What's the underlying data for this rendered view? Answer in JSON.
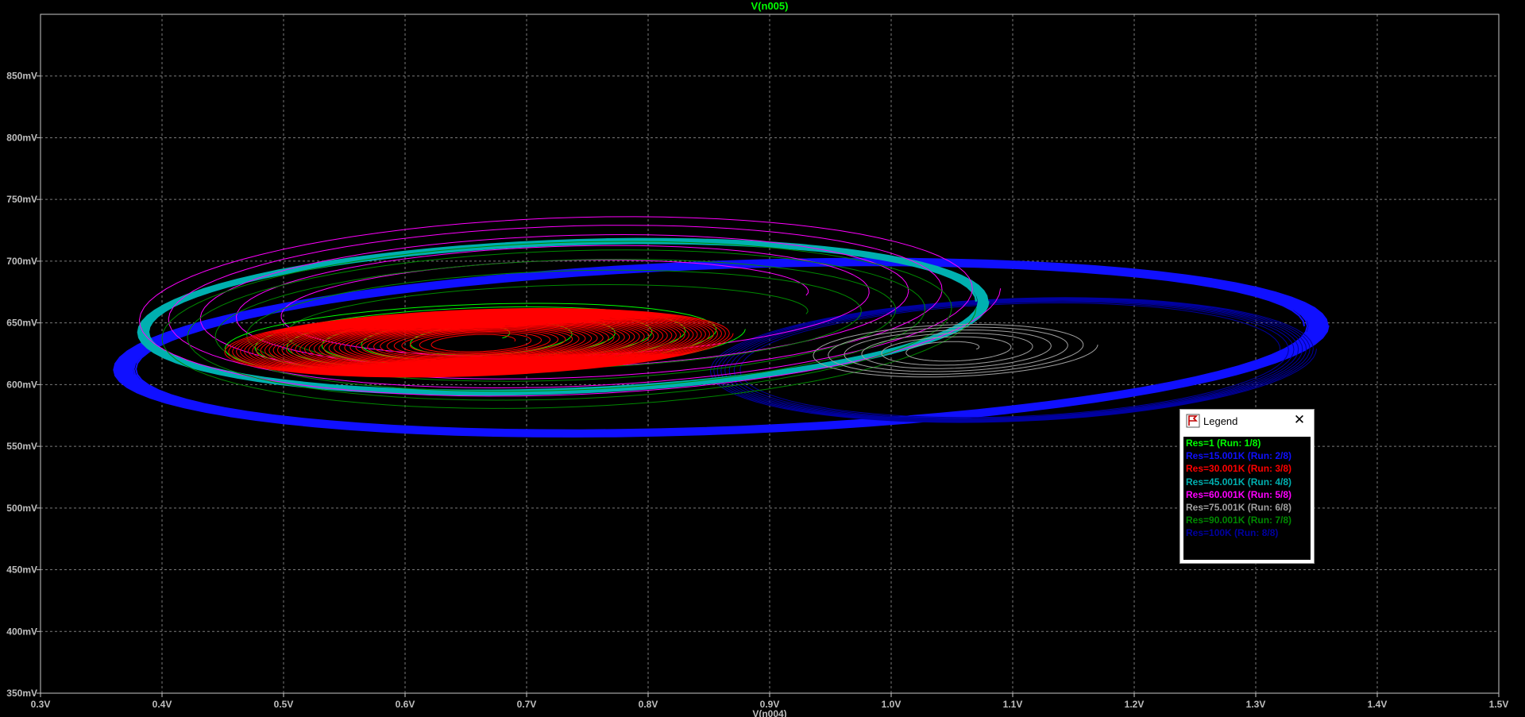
{
  "chart_data": {
    "type": "scatter",
    "title": "V(n005)",
    "xlabel": "V(n004)",
    "xlim": [
      0.3,
      1.5
    ],
    "ylim": [
      350,
      900
    ],
    "xticks": [
      "0.3V",
      "0.4V",
      "0.5V",
      "0.6V",
      "0.7V",
      "0.8V",
      "0.9V",
      "1.0V",
      "1.1V",
      "1.2V",
      "1.3V",
      "1.4V",
      "1.5V"
    ],
    "yticks": [
      "350mV",
      "400mV",
      "450mV",
      "500mV",
      "550mV",
      "600mV",
      "650mV",
      "700mV",
      "750mV",
      "800mV",
      "850mV"
    ],
    "grid": true,
    "legend_position": "bottom-right",
    "series": [
      {
        "name": "Res=1  (Run: 1/8)",
        "color": "#00ff00",
        "center": [
          0.66,
          637
        ],
        "rx": [
          0.02,
          0.22
        ],
        "ry": [
          8,
          30
        ],
        "turns": 6
      },
      {
        "name": "Res=15.001K  (Run: 2/8)",
        "color": "#1010ff",
        "center": [
          0.86,
          630
        ],
        "rx": [
          0.48,
          0.5
        ],
        "ry": [
          64,
          70
        ],
        "turns": 20
      },
      {
        "name": "Res=30.001K  (Run: 3/8)",
        "color": "#ff0000",
        "center": [
          0.66,
          634
        ],
        "rx": [
          0.03,
          0.21
        ],
        "ry": [
          6,
          27
        ],
        "turns": 40
      },
      {
        "name": "Res=45.001K  (Run: 4/8)",
        "color": "#00b0b0",
        "center": [
          0.73,
          655
        ],
        "rx": [
          0.34,
          0.35
        ],
        "ry": [
          58,
          62
        ],
        "turns": 10
      },
      {
        "name": "Res=60.001K  (Run: 5/8)",
        "color": "#ff00ff",
        "center": [
          0.73,
          665
        ],
        "rx": [
          0.2,
          0.36
        ],
        "ry": [
          30,
          75
        ],
        "turns": 5
      },
      {
        "name": "Res=75.001K  (Run: 6/8)",
        "color": "#a0a0a0",
        "center": [
          1.05,
          628
        ],
        "rx": [
          0.02,
          0.12
        ],
        "ry": [
          5,
          22
        ],
        "turns": 6
      },
      {
        "name": "Res=90.001K  (Run: 7/8)",
        "color": "#008800",
        "center": [
          0.73,
          650
        ],
        "rx": [
          0.2,
          0.34
        ],
        "ry": [
          25,
          70
        ],
        "turns": 5
      },
      {
        "name": "Res=100K  (Run: 8/8)",
        "color": "#0000a0",
        "center": [
          1.1,
          620
        ],
        "rx": [
          0.22,
          0.25
        ],
        "ry": [
          45,
          50
        ],
        "turns": 8
      }
    ]
  },
  "legend": {
    "title": "Legend",
    "close_glyph": "✕",
    "icon": "legend-flag-icon"
  }
}
